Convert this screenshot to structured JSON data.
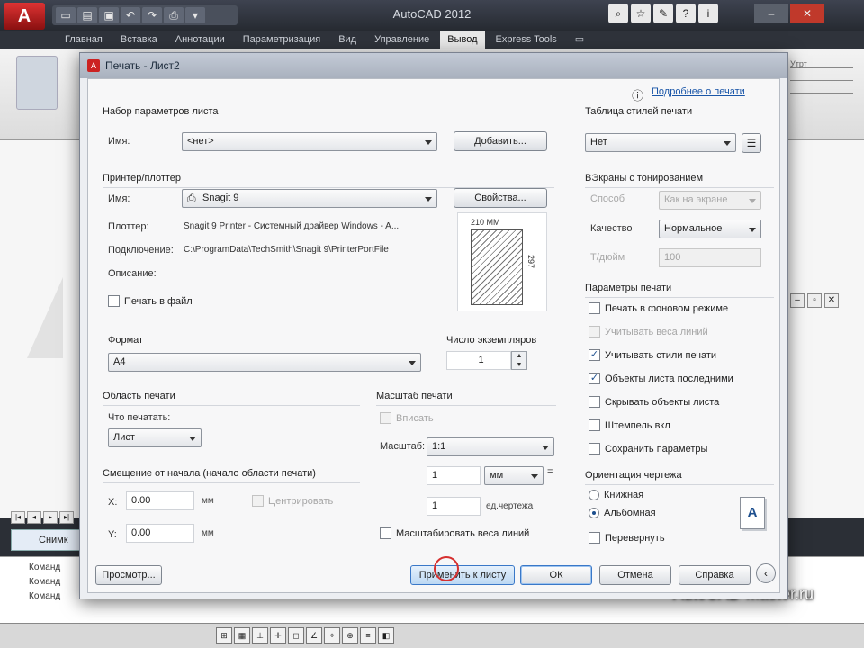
{
  "app": {
    "window_title": "AutoCAD 2012",
    "qat_icons": [
      "new-icon",
      "open-icon",
      "save-icon",
      "undo-icon",
      "redo-icon",
      "plot-icon",
      "dropdown-icon"
    ],
    "ribbon_tabs": [
      {
        "label": "Главная"
      },
      {
        "label": "Вставка"
      },
      {
        "label": "Аннотации"
      },
      {
        "label": "Параметризация"
      },
      {
        "label": "Вид"
      },
      {
        "label": "Управление"
      },
      {
        "label": "Вывод",
        "active": true
      },
      {
        "label": "Express Tools"
      },
      {
        "label": "▭"
      }
    ],
    "right_panel_labels": [
      "Утрт",
      "",
      ""
    ],
    "layout_tab": "Снимк",
    "command_lines": [
      "Команд",
      "Команд",
      "Команд"
    ],
    "watermark": "AutoCAD-Master.ru"
  },
  "dialog": {
    "title": "Печать - Лист2",
    "help_link": "Подробнее о печати",
    "page_setup": {
      "title": "Набор параметров листа",
      "name_label": "Имя:",
      "name_value": "<нет>",
      "add_button": "Добавить..."
    },
    "printer": {
      "title": "Принтер/плоттер",
      "name_label": "Имя:",
      "name_value": "Snagit 9",
      "properties_button": "Свойства...",
      "plotter_label": "Плоттер:",
      "plotter_value": "Snagit 9 Printer - Системный драйвер Windows - A...",
      "location_label": "Подключение:",
      "location_value": "C:\\ProgramData\\TechSmith\\Snagit 9\\PrinterPortFile",
      "description_label": "Описание:",
      "print_to_file": "Печать в файл",
      "preview_width": "210 MM",
      "preview_height": "297"
    },
    "paper": {
      "title": "Формат",
      "value": "A4"
    },
    "copies": {
      "title": "Число экземпляров",
      "value": "1"
    },
    "plot_area": {
      "title": "Область печати",
      "what_label": "Что печатать:",
      "what_value": "Лист"
    },
    "offset": {
      "title": "Смещение от начала (начало области печати)",
      "x_label": "X:",
      "x_value": "0.00",
      "y_label": "Y:",
      "y_value": "0.00",
      "unit": "мм",
      "center_label": "Центрировать"
    },
    "scale": {
      "title": "Масштаб печати",
      "fit_label": "Вписать",
      "scale_label": "Масштаб:",
      "scale_value": "1:1",
      "value1": "1",
      "unit_value": "мм",
      "value2": "1",
      "unit2": "ед.чертежа",
      "lineweights_label": "Масштабировать веса линий"
    },
    "style_table": {
      "title": "Таблица стилей печати",
      "value": "Нет"
    },
    "shaded": {
      "title": "ВЭкраны с тонированием",
      "view_label": "Способ",
      "view_value": "Как на экране",
      "quality_label": "Качество",
      "quality_value": "Нормальное",
      "dpi_label": "Т/дюйм",
      "dpi_value": "100"
    },
    "options": {
      "title": "Параметры печати",
      "items": [
        {
          "label": "Печать в фоновом режиме",
          "checked": false,
          "disabled": false
        },
        {
          "label": "Учитывать веса линий",
          "checked": false,
          "disabled": true
        },
        {
          "label": "Учитывать стили печати",
          "checked": true,
          "disabled": false
        },
        {
          "label": "Объекты листа последними",
          "checked": true,
          "disabled": false
        },
        {
          "label": "Скрывать объекты листа",
          "checked": false,
          "disabled": false
        },
        {
          "label": "Штемпель вкл",
          "checked": false,
          "disabled": false
        },
        {
          "label": "Сохранить параметры",
          "checked": false,
          "disabled": false
        }
      ]
    },
    "orientation": {
      "title": "Ориентация чертежа",
      "portrait": "Книжная",
      "landscape": "Альбомная",
      "upside_down": "Перевернуть",
      "icon_letter": "A"
    },
    "buttons": {
      "preview": "Просмотр...",
      "apply": "Применить к листу",
      "ok": "ОК",
      "cancel": "Отмена",
      "help": "Справка"
    }
  },
  "colors": {
    "accent": "#3a78c8",
    "focus_ring": "#d63030"
  }
}
